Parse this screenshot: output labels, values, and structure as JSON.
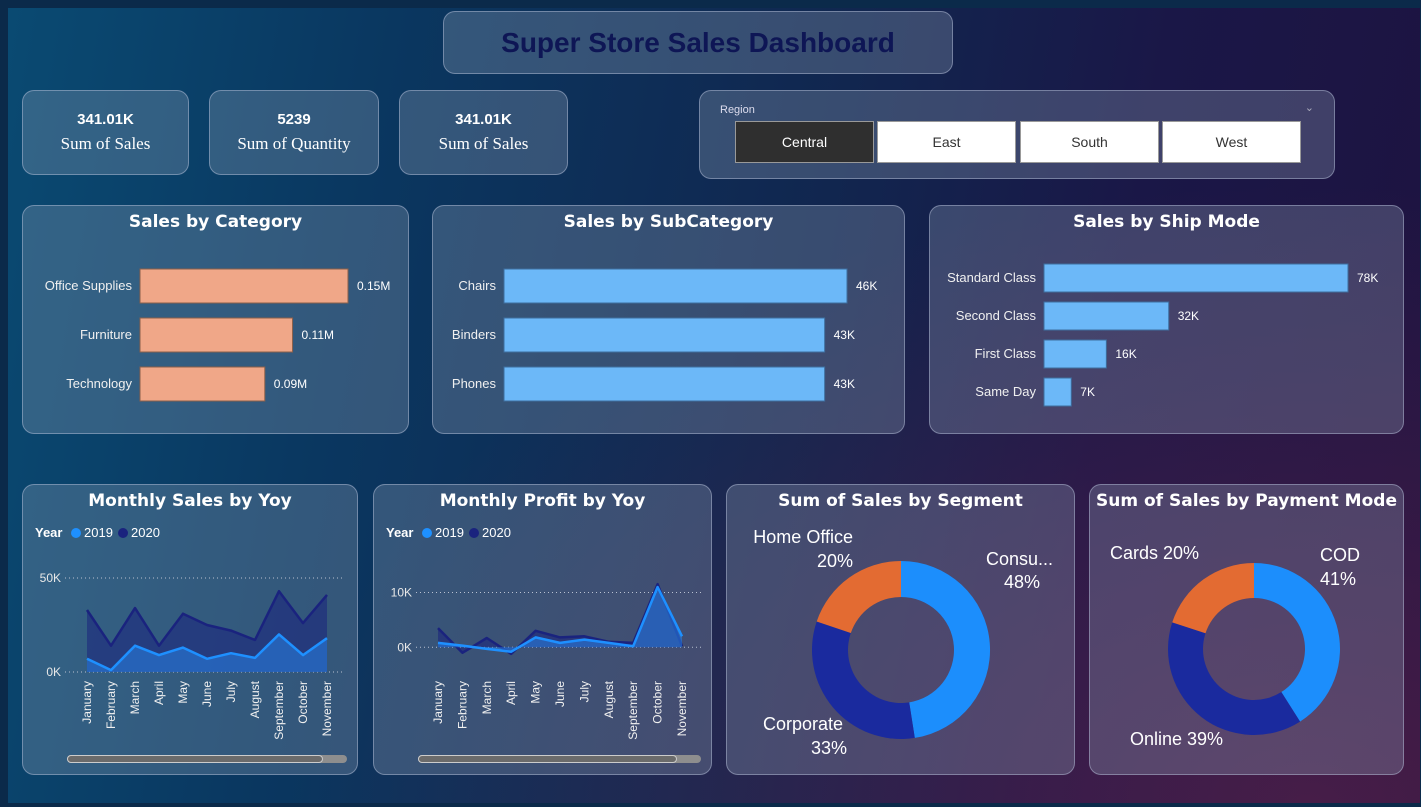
{
  "title": "Super Store Sales Dashboard",
  "kpis": [
    {
      "value": "341.01K",
      "label": "Sum of Sales"
    },
    {
      "value": "5239",
      "label": "Sum of Quantity"
    },
    {
      "value": "341.01K",
      "label": "Sum of Sales"
    }
  ],
  "region_slicer": {
    "label": "Region",
    "options": [
      "Central",
      "East",
      "South",
      "West"
    ],
    "selected": "Central"
  },
  "colors": {
    "category_bar": "#f0a788",
    "subcat_bar": "#6cb8f8",
    "y2019": "#1e90ff",
    "y2020": "#1a237e",
    "orange": "#e36b32",
    "blue_light": "#1c8efc",
    "blue_dark": "#1a2a9e"
  },
  "chart_data": [
    {
      "type": "bar",
      "title": "Sales by Category",
      "categories": [
        "Office Supplies",
        "Furniture",
        "Technology"
      ],
      "values": [
        0.15,
        0.11,
        0.09
      ],
      "labels": [
        "0.15M",
        "0.11M",
        "0.09M"
      ]
    },
    {
      "type": "bar",
      "title": "Sales by SubCategory",
      "categories": [
        "Chairs",
        "Binders",
        "Phones"
      ],
      "values": [
        46,
        43,
        43
      ],
      "labels": [
        "46K",
        "43K",
        "43K"
      ]
    },
    {
      "type": "bar",
      "title": "Sales by Ship Mode",
      "categories": [
        "Standard Class",
        "Second Class",
        "First Class",
        "Same Day"
      ],
      "values": [
        78,
        32,
        16,
        7
      ],
      "labels": [
        "78K",
        "32K",
        "16K",
        "7K"
      ]
    },
    {
      "type": "area",
      "title": "Monthly Sales by Yoy",
      "legend_title": "Year",
      "categories": [
        "January",
        "February",
        "March",
        "April",
        "May",
        "June",
        "July",
        "August",
        "September",
        "October",
        "November"
      ],
      "yticks": [
        "50K",
        "0K"
      ],
      "ylim": [
        0,
        50000
      ],
      "series": [
        {
          "name": "2019",
          "values": [
            7000,
            1000,
            14000,
            9000,
            13000,
            7000,
            10000,
            7500,
            20000,
            9000,
            18000
          ]
        },
        {
          "name": "2020",
          "values": [
            33000,
            14000,
            34000,
            14000,
            31000,
            25000,
            22000,
            17000,
            43000,
            26000,
            41000
          ]
        }
      ]
    },
    {
      "type": "area",
      "title": "Monthly Profit by Yoy",
      "legend_title": "Year",
      "categories": [
        "January",
        "February",
        "March",
        "April",
        "May",
        "June",
        "July",
        "August",
        "September",
        "October",
        "November"
      ],
      "yticks": [
        "10K",
        "0K"
      ],
      "ylim": [
        -2500,
        13000
      ],
      "series": [
        {
          "name": "2019",
          "values": [
            800,
            300,
            -300,
            -800,
            1800,
            800,
            1400,
            800,
            200,
            11000,
            2000
          ]
        },
        {
          "name": "2020",
          "values": [
            3500,
            -1000,
            1700,
            -1200,
            3000,
            1800,
            2000,
            1000,
            800,
            11500,
            200
          ]
        }
      ]
    },
    {
      "type": "pie",
      "title": "Sum of Sales by Segment",
      "slices": [
        {
          "label": "Consu...",
          "pct": "48%",
          "value": 48
        },
        {
          "label": "Corporate",
          "pct": "33%",
          "value": 33
        },
        {
          "label": "Home Office",
          "pct": "20%",
          "value": 20
        }
      ]
    },
    {
      "type": "pie",
      "title": "Sum of Sales by Payment Mode",
      "slices": [
        {
          "label": "COD",
          "pct": "41%",
          "value": 41
        },
        {
          "label": "Online",
          "pct": "39%",
          "value": 39
        },
        {
          "label": "Cards",
          "pct": "20%",
          "value": 20
        }
      ]
    }
  ]
}
